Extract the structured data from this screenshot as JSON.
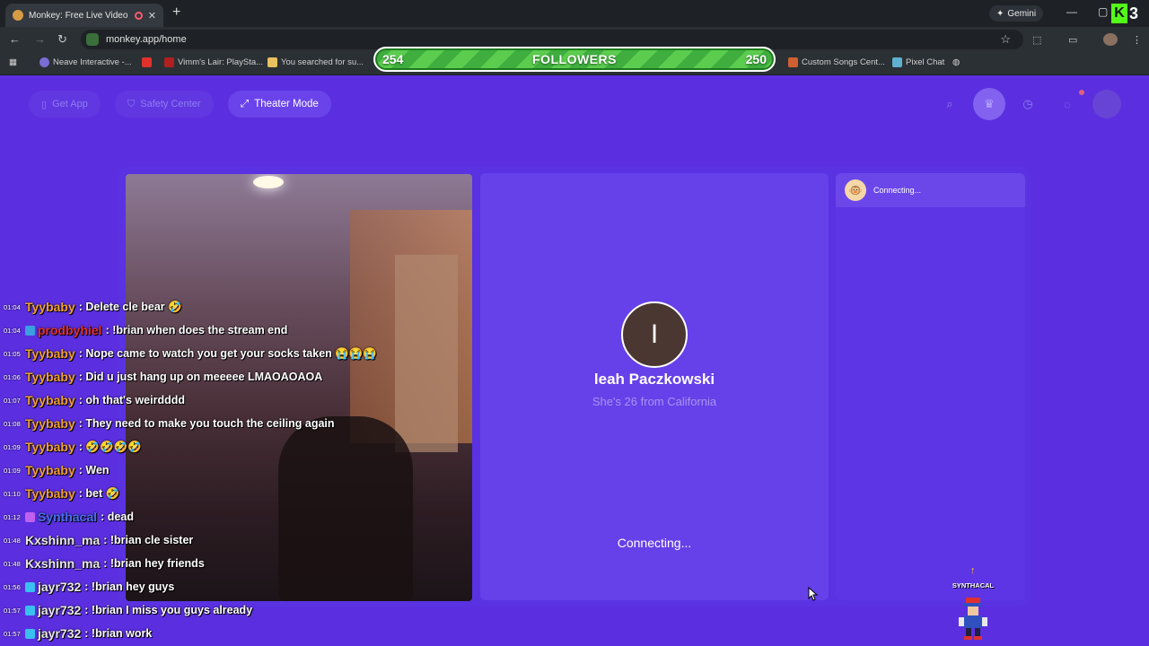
{
  "browser": {
    "tab_title": "Monkey: Free Live Video Chat",
    "gemini_label": "Gemini",
    "url": "monkey.app/home",
    "bookmarks": [
      {
        "label": "Neave Interactive -...",
        "color": "#7b6cd6"
      },
      {
        "label": "",
        "color": "#e0312b"
      },
      {
        "label": "Vimm's Lair: PlaySta...",
        "color": "#b02020"
      },
      {
        "label": "You searched for su...",
        "color": "#e8c060"
      },
      {
        "label": "Custom Songs Cent...",
        "color": "#d06030"
      },
      {
        "label": "Pixel Chat",
        "color": "#5fb0d0"
      }
    ],
    "kick_letter": "K",
    "kick_count": "3"
  },
  "followers": {
    "current": "254",
    "label": "FOLLOWERS",
    "goal": "250"
  },
  "monkey": {
    "get_app": "Get App",
    "safety_center": "Safety Center",
    "theater_mode": "Theater Mode",
    "profile_initial": "I",
    "profile_name": "leah Paczkowski",
    "profile_info": "She's 26 from California",
    "connecting_main": "Connecting...",
    "chat_status": "Connecting..."
  },
  "stream_chat": [
    {
      "time": "01:04",
      "user": "Tyybaby",
      "color": "#f0a030",
      "text": ": Delete cle bear 🤣",
      "icon": ""
    },
    {
      "time": "01:04",
      "user": "prodbyhiel",
      "color": "#e0302a",
      "text": ": !brian when does the stream end",
      "icon": "#3aa0e0"
    },
    {
      "time": "01:05",
      "user": "Tyybaby",
      "color": "#f0a030",
      "text": ": Nope came to watch you get your socks taken 😭😭😭",
      "icon": ""
    },
    {
      "time": "01:06",
      "user": "Tyybaby",
      "color": "#f0a030",
      "text": ": Did u just hang up on meeeee LMAOAOAOA",
      "icon": ""
    },
    {
      "time": "01:07",
      "user": "Tyybaby",
      "color": "#f0a030",
      "text": ": oh that's weirdddd",
      "icon": ""
    },
    {
      "time": "01:08",
      "user": "Tyybaby",
      "color": "#f0a030",
      "text": ": They need to make you touch the ceiling again",
      "icon": ""
    },
    {
      "time": "01:09",
      "user": "Tyybaby",
      "color": "#f0a030",
      "text": ": 🤣🤣🤣🤣",
      "icon": ""
    },
    {
      "time": "01:09",
      "user": "Tyybaby",
      "color": "#f0a030",
      "text": ": Wen",
      "icon": ""
    },
    {
      "time": "01:10",
      "user": "Tyybaby",
      "color": "#f0a030",
      "text": ": bet 🤣",
      "icon": ""
    },
    {
      "time": "01:12",
      "user": "Synthacal",
      "color": "#4a6ef0",
      "text": ": dead",
      "icon": "#c060f0"
    },
    {
      "time": "01:48",
      "user": "Kxshinn_ma",
      "color": "#e8e8e8",
      "text": ": !brian cle sister",
      "icon": ""
    },
    {
      "time": "01:48",
      "user": "Kxshinn_ma",
      "color": "#e8e8e8",
      "text": ": !brian hey friends",
      "icon": ""
    },
    {
      "time": "01:56",
      "user": "jayr732",
      "color": "#e8e8e8",
      "text": ": !brian hey guys",
      "icon": "#3ac0f0"
    },
    {
      "time": "01:57",
      "user": "jayr732",
      "color": "#e8e8e8",
      "text": ": !brian I miss you guys already",
      "icon": "#3ac0f0"
    },
    {
      "time": "01:57",
      "user": "jayr732",
      "color": "#e8e8e8",
      "text": ": !brian work",
      "icon": "#3ac0f0"
    }
  ],
  "mascot": {
    "label": "SYNTHACAL"
  }
}
